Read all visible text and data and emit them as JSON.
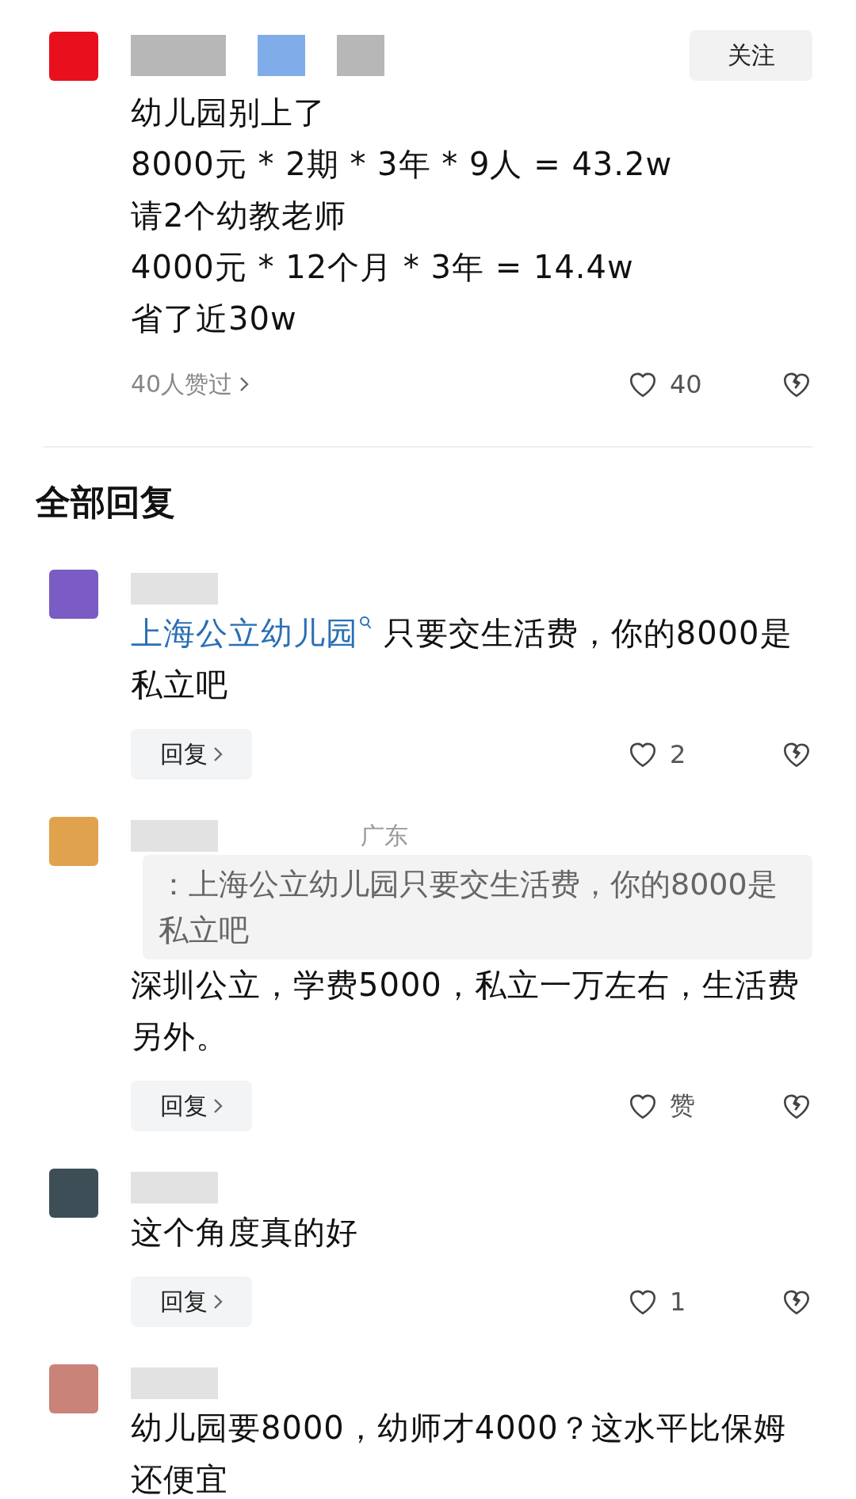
{
  "main_comment": {
    "color": "#e8101c",
    "follow": "关注",
    "lines": [
      "幼儿园别上了",
      "8000元 * 2期 * 3年 * 9人 = 43.2w",
      "请2个幼教老师",
      "4000元 * 12个月 * 3年 = 14.4w",
      "省了近30w"
    ],
    "likers": "40人赞过",
    "likes": "40"
  },
  "section_title": "全部回复",
  "replies": [
    {
      "color": "#7a5cc4",
      "link": "上海公立幼儿园",
      "text": " 只要交生活费，你的8000是私立吧",
      "reply": "回复",
      "likes": "2"
    },
    {
      "color": "#e0a24c",
      "meta": "广东",
      "quote": "：上海公立幼儿园只要交生活费，你的8000是私立吧",
      "text": "深圳公立，学费5000，私立一万左右，生活费另外。",
      "reply": "回复",
      "likes": "赞"
    },
    {
      "color": "#3e4e57",
      "text": "这个角度真的好",
      "reply": "回复",
      "likes": "1"
    },
    {
      "color": "#c98378",
      "text": "幼儿园要8000，幼师才4000？这水平比保姆还便宜"
    }
  ]
}
